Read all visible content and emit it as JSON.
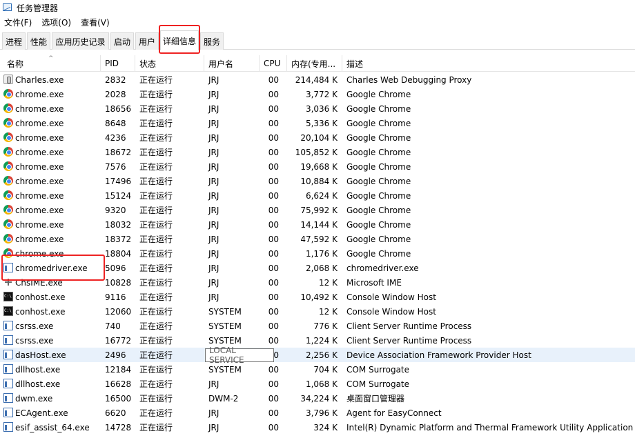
{
  "window": {
    "title": "任务管理器"
  },
  "menu": [
    "文件(F)",
    "选项(O)",
    "查看(V)"
  ],
  "tabs": [
    "进程",
    "性能",
    "应用历史记录",
    "启动",
    "用户",
    "详细信息",
    "服务"
  ],
  "columns": [
    "名称",
    "PID",
    "状态",
    "用户名",
    "CPU",
    "内存(专用...",
    "描述"
  ],
  "tooltip": "LOCAL SERVICE",
  "rows": [
    {
      "icon": "charles-icon",
      "name": "Charles.exe",
      "pid": "2832",
      "status": "正在运行",
      "user": "JRJ",
      "cpu": "00",
      "mem": "214,484 K",
      "desc": "Charles Web Debugging Proxy"
    },
    {
      "icon": "chrome-icon",
      "name": "chrome.exe",
      "pid": "2028",
      "status": "正在运行",
      "user": "JRJ",
      "cpu": "00",
      "mem": "3,772 K",
      "desc": "Google Chrome"
    },
    {
      "icon": "chrome-icon",
      "name": "chrome.exe",
      "pid": "18656",
      "status": "正在运行",
      "user": "JRJ",
      "cpu": "00",
      "mem": "3,036 K",
      "desc": "Google Chrome"
    },
    {
      "icon": "chrome-icon",
      "name": "chrome.exe",
      "pid": "8648",
      "status": "正在运行",
      "user": "JRJ",
      "cpu": "00",
      "mem": "5,336 K",
      "desc": "Google Chrome"
    },
    {
      "icon": "chrome-icon",
      "name": "chrome.exe",
      "pid": "4236",
      "status": "正在运行",
      "user": "JRJ",
      "cpu": "00",
      "mem": "20,104 K",
      "desc": "Google Chrome"
    },
    {
      "icon": "chrome-icon",
      "name": "chrome.exe",
      "pid": "18672",
      "status": "正在运行",
      "user": "JRJ",
      "cpu": "00",
      "mem": "105,852 K",
      "desc": "Google Chrome"
    },
    {
      "icon": "chrome-icon",
      "name": "chrome.exe",
      "pid": "7576",
      "status": "正在运行",
      "user": "JRJ",
      "cpu": "00",
      "mem": "19,668 K",
      "desc": "Google Chrome"
    },
    {
      "icon": "chrome-icon",
      "name": "chrome.exe",
      "pid": "17496",
      "status": "正在运行",
      "user": "JRJ",
      "cpu": "00",
      "mem": "10,884 K",
      "desc": "Google Chrome"
    },
    {
      "icon": "chrome-icon",
      "name": "chrome.exe",
      "pid": "15124",
      "status": "正在运行",
      "user": "JRJ",
      "cpu": "00",
      "mem": "6,624 K",
      "desc": "Google Chrome"
    },
    {
      "icon": "chrome-icon",
      "name": "chrome.exe",
      "pid": "9320",
      "status": "正在运行",
      "user": "JRJ",
      "cpu": "00",
      "mem": "75,992 K",
      "desc": "Google Chrome"
    },
    {
      "icon": "chrome-icon",
      "name": "chrome.exe",
      "pid": "18032",
      "status": "正在运行",
      "user": "JRJ",
      "cpu": "00",
      "mem": "14,144 K",
      "desc": "Google Chrome"
    },
    {
      "icon": "chrome-icon",
      "name": "chrome.exe",
      "pid": "18372",
      "status": "正在运行",
      "user": "JRJ",
      "cpu": "00",
      "mem": "47,592 K",
      "desc": "Google Chrome"
    },
    {
      "icon": "chrome-icon",
      "name": "chrome.exe",
      "pid": "18804",
      "status": "正在运行",
      "user": "JRJ",
      "cpu": "00",
      "mem": "1,176 K",
      "desc": "Google Chrome"
    },
    {
      "icon": "app-icon",
      "name": "chromedriver.exe",
      "pid": "5096",
      "status": "正在运行",
      "user": "JRJ",
      "cpu": "00",
      "mem": "2,068 K",
      "desc": "chromedriver.exe"
    },
    {
      "icon": "ime-icon",
      "name": "ChsIME.exe",
      "pid": "10828",
      "status": "正在运行",
      "user": "JRJ",
      "cpu": "00",
      "mem": "12 K",
      "desc": "Microsoft IME"
    },
    {
      "icon": "console-icon",
      "name": "conhost.exe",
      "pid": "9116",
      "status": "正在运行",
      "user": "JRJ",
      "cpu": "00",
      "mem": "10,492 K",
      "desc": "Console Window Host"
    },
    {
      "icon": "console-icon",
      "name": "conhost.exe",
      "pid": "12060",
      "status": "正在运行",
      "user": "SYSTEM",
      "cpu": "00",
      "mem": "12 K",
      "desc": "Console Window Host"
    },
    {
      "icon": "app-icon",
      "name": "csrss.exe",
      "pid": "740",
      "status": "正在运行",
      "user": "SYSTEM",
      "cpu": "00",
      "mem": "776 K",
      "desc": "Client Server Runtime Process"
    },
    {
      "icon": "app-icon",
      "name": "csrss.exe",
      "pid": "16772",
      "status": "正在运行",
      "user": "SYSTEM",
      "cpu": "00",
      "mem": "1,224 K",
      "desc": "Client Server Runtime Process"
    },
    {
      "icon": "app-icon",
      "name": "dasHost.exe",
      "pid": "2496",
      "status": "正在运行",
      "user": "",
      "cpu": "00",
      "mem": "2,256 K",
      "desc": "Device Association Framework Provider Host"
    },
    {
      "icon": "app-icon",
      "name": "dllhost.exe",
      "pid": "12184",
      "status": "正在运行",
      "user": "SYSTEM",
      "cpu": "00",
      "mem": "704 K",
      "desc": "COM Surrogate"
    },
    {
      "icon": "app-icon",
      "name": "dllhost.exe",
      "pid": "16628",
      "status": "正在运行",
      "user": "JRJ",
      "cpu": "00",
      "mem": "1,068 K",
      "desc": "COM Surrogate"
    },
    {
      "icon": "app-icon",
      "name": "dwm.exe",
      "pid": "16500",
      "status": "正在运行",
      "user": "DWM-2",
      "cpu": "00",
      "mem": "34,224 K",
      "desc": "桌面窗口管理器"
    },
    {
      "icon": "app-icon",
      "name": "ECAgent.exe",
      "pid": "6620",
      "status": "正在运行",
      "user": "JRJ",
      "cpu": "00",
      "mem": "3,796 K",
      "desc": "Agent for EasyConnect"
    },
    {
      "icon": "app-icon",
      "name": "esif_assist_64.exe",
      "pid": "14728",
      "status": "正在运行",
      "user": "JRJ",
      "cpu": "00",
      "mem": "324 K",
      "desc": "Intel(R) Dynamic Platform and Thermal Framework Utility Application"
    }
  ]
}
